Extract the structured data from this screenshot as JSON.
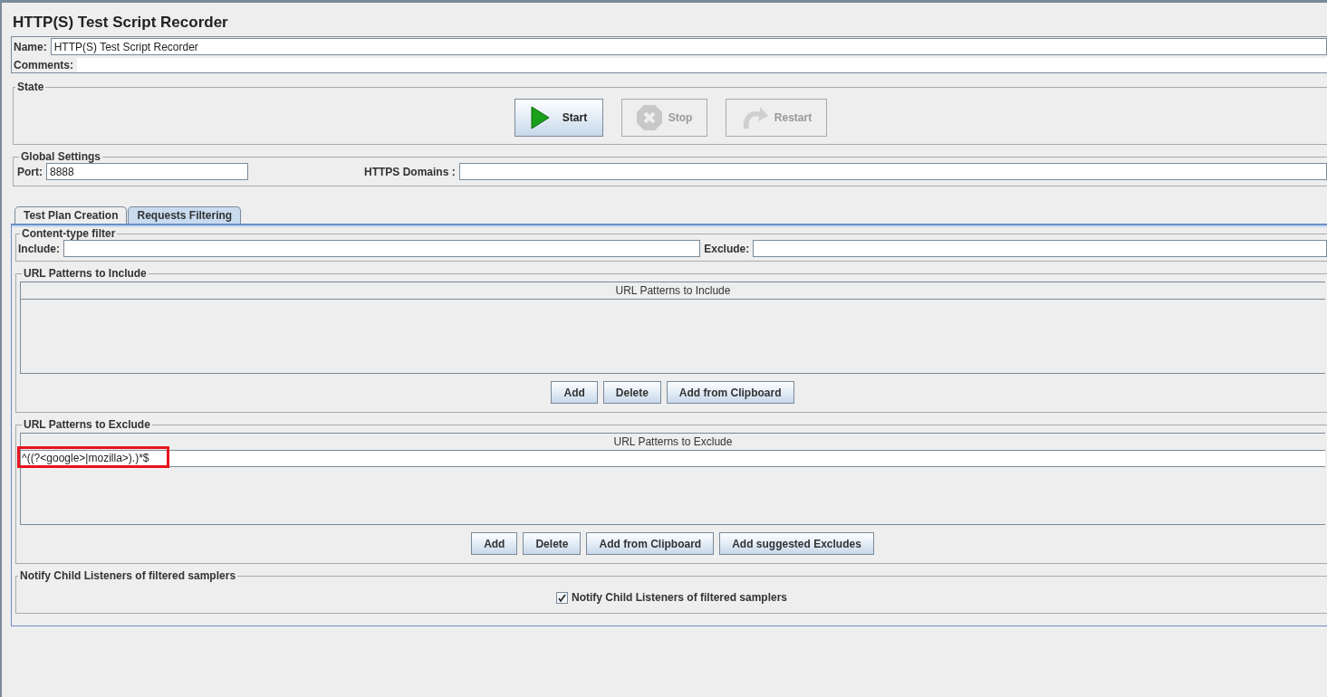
{
  "title": "HTTP(S) Test Script Recorder",
  "name": {
    "label": "Name:",
    "value": "HTTP(S) Test Script Recorder"
  },
  "comments": {
    "label": "Comments:"
  },
  "state": {
    "title": "State",
    "buttons": [
      {
        "label": "Start",
        "kind": "start",
        "disabled": false
      },
      {
        "label": "Stop",
        "kind": "stop",
        "disabled": true
      },
      {
        "label": "Restart",
        "kind": "restart",
        "disabled": true
      }
    ]
  },
  "global_settings": {
    "title": "Global Settings",
    "port_label": "Port:",
    "port_value": "8888",
    "https_label": "HTTPS Domains :"
  },
  "tabs": [
    {
      "label": "Test Plan Creation",
      "selected": false
    },
    {
      "label": "Requests Filtering",
      "selected": true
    }
  ],
  "content_type_filter": {
    "title": "Content-type filter",
    "include_label": "Include:",
    "exclude_label": "Exclude:"
  },
  "include_patterns": {
    "title": "URL Patterns to Include",
    "column": "URL Patterns to Include",
    "buttons": [
      "Add",
      "Delete",
      "Add from Clipboard"
    ]
  },
  "exclude_patterns": {
    "title": "URL Patterns to Exclude",
    "column": "URL Patterns to Exclude",
    "rows": [
      {
        "value": "^((?<google>|mozilla>).)*$",
        "highlighted": true
      }
    ],
    "buttons": [
      "Add",
      "Delete",
      "Add from Clipboard",
      "Add suggested Excludes"
    ]
  },
  "notify": {
    "title": "Notify Child Listeners of filtered samplers",
    "label": "Notify Child Listeners of filtered samplers",
    "checked": true
  }
}
